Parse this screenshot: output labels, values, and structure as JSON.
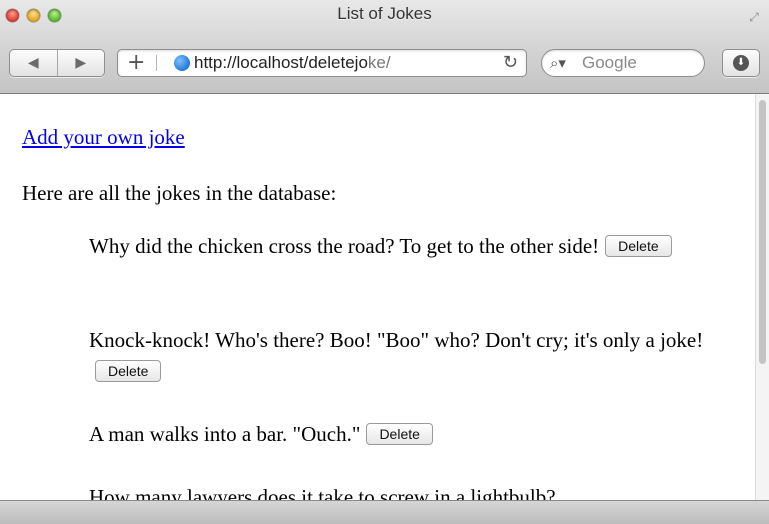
{
  "window": {
    "title": "List of Jokes"
  },
  "toolbar": {
    "back_icon": "back-arrow-icon",
    "forward_icon": "forward-arrow-icon",
    "add_tab_glyph": "+",
    "url_main": "http://localhost/deletejo",
    "url_tail": "ke/",
    "search_placeholder": "Google"
  },
  "page": {
    "add_link": "Add your own joke",
    "intro": "Here are all the jokes in the database:",
    "delete_label": "Delete",
    "jokes": [
      "Why did the chicken cross the road? To get to the other side!",
      "Knock-knock! Who's there? Boo! \"Boo\" who? Don't cry; it's only a joke!",
      "A man walks into a bar. \"Ouch.\"",
      "How many lawyers does it take to screw in a lightbulb?"
    ]
  },
  "colors": {
    "link": "#0000ee",
    "chrome": "#d3d3d3"
  }
}
